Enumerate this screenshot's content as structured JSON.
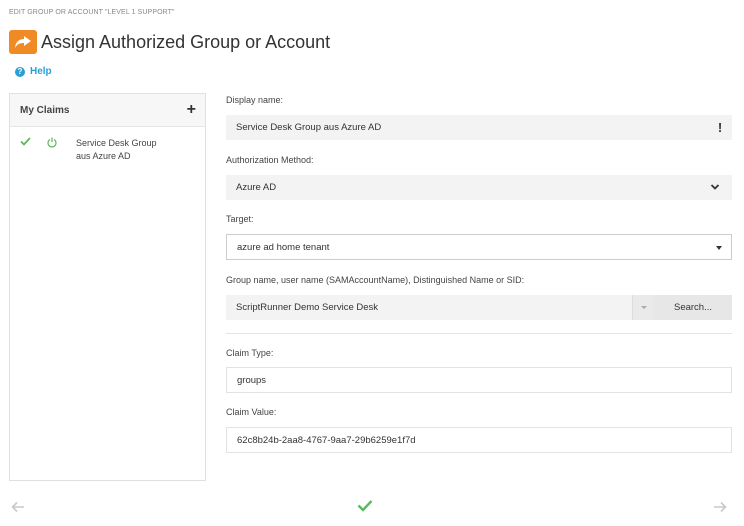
{
  "breadcrumb": "EDIT GROUP OR ACCOUNT \"LEVEL 1 SUPPORT\"",
  "title": "Assign Authorized Group or Account",
  "help_label": "Help",
  "claims": {
    "header": "My Claims",
    "add_symbol": "+",
    "items": [
      {
        "label_line1": "Service Desk Group",
        "label_line2": "aus Azure AD",
        "status": "active"
      }
    ]
  },
  "form": {
    "display_name": {
      "label": "Display name:",
      "value": "Service Desk Group aus Azure AD",
      "indicator": "!"
    },
    "auth_method": {
      "label": "Authorization Method:",
      "value": "Azure AD"
    },
    "target": {
      "label": "Target:",
      "value": "azure ad home tenant"
    },
    "group_name": {
      "label": "Group name, user name (SAMAccountName), Distinguished Name or SID:",
      "value": "ScriptRunner Demo Service Desk",
      "search_label": "Search..."
    },
    "claim_type": {
      "label": "Claim Type:",
      "value": "groups"
    },
    "claim_value": {
      "label": "Claim Value:",
      "value": "62c8b24b-2aa8-4767-9aa7-29b6259e1f7d"
    }
  },
  "colors": {
    "accent_orange": "#f08a24",
    "link_blue": "#2a9fd6",
    "success_green": "#5cb85c"
  },
  "icons": {
    "title": "share-arrow-icon",
    "help": "question-circle-icon",
    "prev": "arrow-left-icon",
    "confirm": "check-icon",
    "next": "arrow-right-icon"
  }
}
